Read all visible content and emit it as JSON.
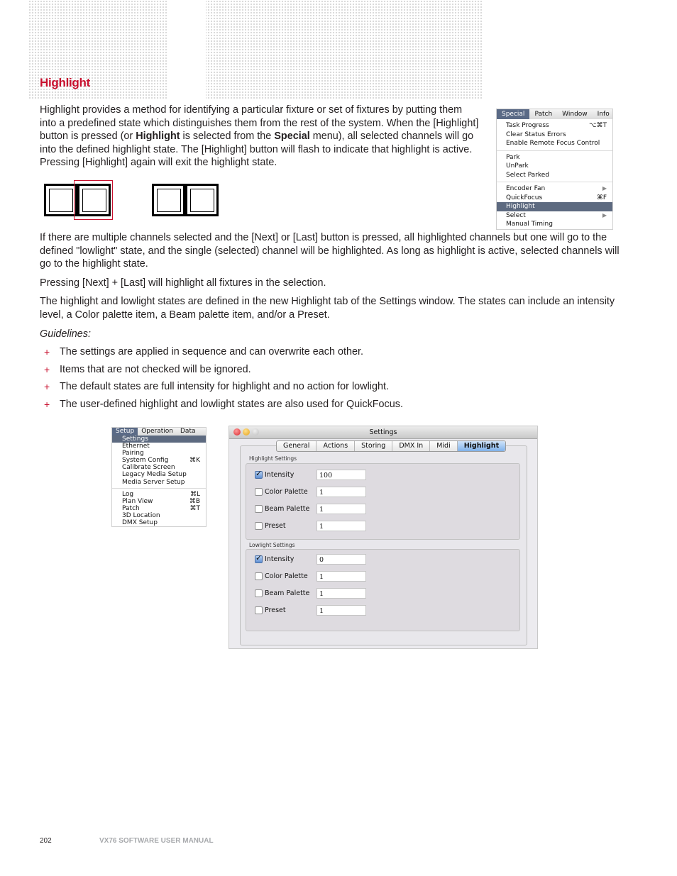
{
  "section": {
    "title": "Highlight"
  },
  "intro": {
    "part1": "Highlight provides a method for identifying a particular fixture or set of fixtures by putting them into a predefined state which distinguishes them from the rest of the system. When the [Highlight] button is pressed (or ",
    "bold1": "Highlight",
    "part2": " is selected from the ",
    "bold2": "Special",
    "part3": " menu), all selected channels will go into the defined highlight state. The [Highlight] button will flash to indicate that highlight is active. Pressing [Highlight] again will exit the highlight state."
  },
  "paragraphs": {
    "next_last": "If there are multiple channels selected and the [Next] or [Last] button is pressed, all highlighted channels but one will go to the defined \"lowlight\" state, and the single (selected) channel will be highlighted. As long as highlight is active, selected channels will go to the highlight state.",
    "pressing": "Pressing [Next] + [Last] will highlight all fixtures in the selection.",
    "states": "The highlight and lowlight states are defined in the new Highlight tab of the Settings window. The states can include an intensity level, a Color palette item, a Beam palette item, and/or a Preset.",
    "guidelines": "Guidelines:"
  },
  "guidelines": [
    "The settings are applied in sequence and can overwrite each other.",
    "Items that are not checked will be ignored.",
    "The default states are full intensity for highlight and no action for lowlight.",
    "The user-defined highlight and lowlight states are also used for QuickFocus."
  ],
  "bullet_glyph": "+",
  "special_menu": {
    "bar": [
      "Special",
      "Patch",
      "Window",
      "Info"
    ],
    "groups": [
      [
        {
          "label": "Task Progress",
          "shortcut": "⌥⌘T"
        },
        {
          "label": "Clear Status Errors",
          "shortcut": ""
        },
        {
          "label": "Enable Remote Focus Control",
          "shortcut": ""
        }
      ],
      [
        {
          "label": "Park",
          "shortcut": ""
        },
        {
          "label": "UnPark",
          "shortcut": ""
        },
        {
          "label": "Select Parked",
          "shortcut": ""
        }
      ],
      [
        {
          "label": "Encoder Fan",
          "shortcut": "▶"
        },
        {
          "label": "QuickFocus",
          "shortcut": "⌘F"
        },
        {
          "label": "Highlight",
          "shortcut": "",
          "selected": true
        },
        {
          "label": "Select",
          "shortcut": "▶"
        },
        {
          "label": "Manual Timing",
          "shortcut": ""
        }
      ]
    ]
  },
  "setup_menu": {
    "bar": [
      "Setup",
      "Operation",
      "Data"
    ],
    "groups": [
      [
        {
          "label": "Settings",
          "shortcut": "",
          "selected": true
        },
        {
          "label": "Ethernet",
          "shortcut": ""
        },
        {
          "label": "Pairing",
          "shortcut": ""
        },
        {
          "label": "System Config",
          "shortcut": "⌘K"
        },
        {
          "label": "Calibrate Screen",
          "shortcut": ""
        },
        {
          "label": "Legacy Media Setup",
          "shortcut": ""
        },
        {
          "label": "Media Server Setup",
          "shortcut": ""
        }
      ],
      [
        {
          "label": "Log",
          "shortcut": "⌘L"
        },
        {
          "label": "Plan View",
          "shortcut": "⌘B"
        },
        {
          "label": "Patch",
          "shortcut": "⌘T"
        },
        {
          "label": "3D Location",
          "shortcut": ""
        },
        {
          "label": "DMX Setup",
          "shortcut": ""
        }
      ]
    ]
  },
  "settings_window": {
    "title": "Settings",
    "tabs": [
      "General",
      "Actions",
      "Storing",
      "DMX In",
      "Midi",
      "Highlight"
    ],
    "active_tab": "Highlight",
    "highlight": {
      "label": "Highlight Settings",
      "rows": [
        {
          "label": "Intensity",
          "checked": true,
          "value": "100"
        },
        {
          "label": "Color Palette",
          "checked": false,
          "value": "1"
        },
        {
          "label": "Beam Palette",
          "checked": false,
          "value": "1"
        },
        {
          "label": "Preset",
          "checked": false,
          "value": "1"
        }
      ]
    },
    "lowlight": {
      "label": "Lowlight Settings",
      "rows": [
        {
          "label": "Intensity",
          "checked": true,
          "value": "0"
        },
        {
          "label": "Color Palette",
          "checked": false,
          "value": "1"
        },
        {
          "label": "Beam Palette",
          "checked": false,
          "value": "1"
        },
        {
          "label": "Preset",
          "checked": false,
          "value": "1"
        }
      ]
    }
  },
  "footer": {
    "page_number": "202",
    "manual_title": "VX76 SOFTWARE USER MANUAL"
  },
  "colors": {
    "accent": "#c8102e",
    "text": "#231f20",
    "footer_gray": "#a7a9ac"
  }
}
